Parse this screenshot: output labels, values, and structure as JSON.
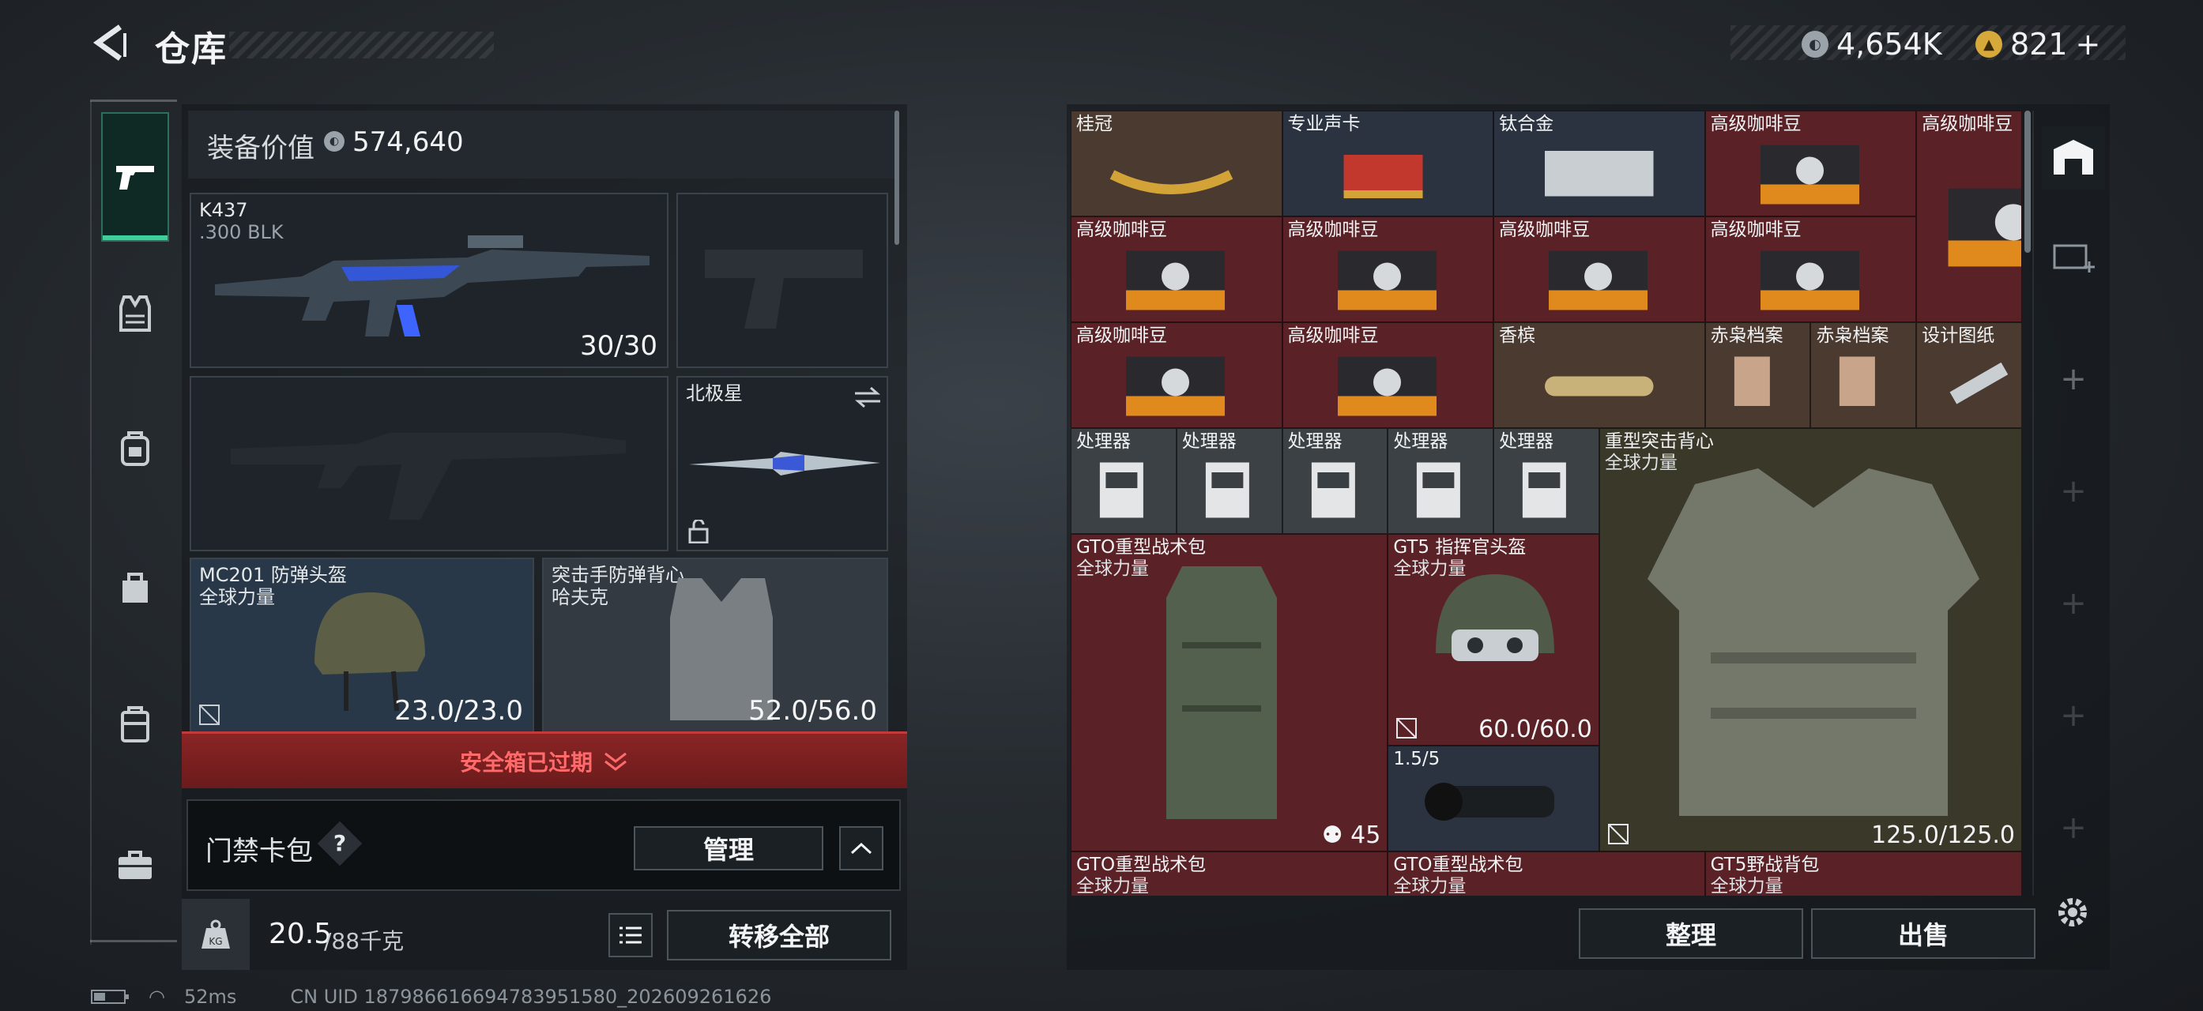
{
  "header": {
    "title": "仓库",
    "currency_a": "4,654K",
    "currency_b": "821",
    "currency_b_plus": "+"
  },
  "equipment": {
    "value_label": "装备价值",
    "value": "574,640",
    "primary": {
      "name": "K437",
      "ammo": ".300 BLK",
      "count": "30/30"
    },
    "secondary_label": "北极星",
    "helmet": {
      "name": "MC201 防弹头盔",
      "faction": "全球力量",
      "durability": "23.0/23.0"
    },
    "vest": {
      "name": "突击手防弹背心",
      "faction": "哈夫克",
      "durability": "52.0/56.0"
    },
    "safebox_status": "安全箱已过期",
    "keycard": {
      "label": "门禁卡包",
      "help": "?",
      "manage": "管理"
    },
    "weight": {
      "current": "20.5",
      "max": "/88千克",
      "transfer_all": "转移全部"
    }
  },
  "grid": {
    "items": [
      {
        "label": "桂冠",
        "color": "brown"
      },
      {
        "label": "专业声卡",
        "color": "blue"
      },
      {
        "label": "钛合金",
        "color": "blue"
      },
      {
        "label": "高级咖啡豆",
        "color": "red"
      },
      {
        "label": "高级咖啡豆",
        "color": "red"
      },
      {
        "label": "高级咖啡豆",
        "color": "red"
      },
      {
        "label": "高级咖啡豆",
        "color": "red"
      },
      {
        "label": "高级咖啡豆",
        "color": "red"
      },
      {
        "label": "高级咖啡豆",
        "color": "red"
      },
      {
        "label": "高级咖啡豆",
        "color": "red"
      },
      {
        "label": "高级咖啡豆",
        "color": "red"
      },
      {
        "label": "香槟",
        "color": "brown"
      },
      {
        "label": "赤枭档案",
        "color": "brown"
      },
      {
        "label": "赤枭档案",
        "color": "brown"
      },
      {
        "label": "设计图纸",
        "color": "brown"
      },
      {
        "label": "处理器",
        "color": "grey"
      },
      {
        "label": "处理器",
        "color": "grey"
      },
      {
        "label": "处理器",
        "color": "grey"
      },
      {
        "label": "处理器",
        "color": "grey"
      },
      {
        "label": "处理器",
        "color": "grey"
      }
    ],
    "big": {
      "vest": {
        "name": "重型突击背心",
        "faction": "全球力量",
        "durability": "125.0/125.0"
      },
      "backpack": {
        "name": "GTO重型战术包",
        "faction": "全球力量",
        "count": "45"
      },
      "helmet": {
        "name": "GT5 指挥官头盔",
        "faction": "全球力量",
        "durability": "60.0/60.0"
      },
      "scope": {
        "name": "1.5/5"
      },
      "row_bottom": [
        {
          "name": "GTO重型战术包",
          "faction": "全球力量"
        },
        {
          "name": "GTO重型战术包",
          "faction": "全球力量"
        },
        {
          "name": "GT5野战背包",
          "faction": "全球力量"
        }
      ]
    },
    "actions": {
      "sort": "整理",
      "sell": "出售"
    }
  },
  "status_bar": {
    "ping": "52ms",
    "uid": "CN UID 187986616694783951580_202609261626"
  },
  "colors": {
    "accent": "#3fcf9b",
    "red_cell": "#5a2226",
    "warning": "#ff6b6b"
  }
}
